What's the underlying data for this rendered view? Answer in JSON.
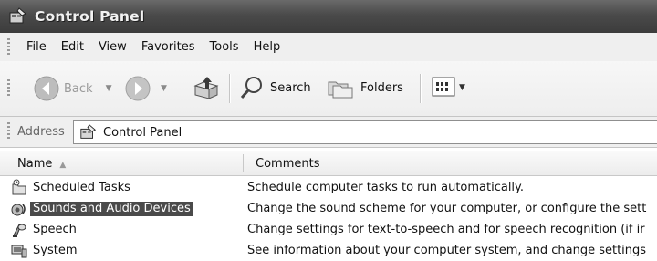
{
  "window": {
    "title": "Control Panel",
    "title_icon": "control-panel-icon"
  },
  "menu": [
    "File",
    "Edit",
    "View",
    "Favorites",
    "Tools",
    "Help"
  ],
  "toolbar": {
    "back_label": "Back",
    "search_label": "Search",
    "folders_label": "Folders",
    "icons": {
      "back": "back-arrow-icon",
      "forward": "forward-arrow-icon",
      "up": "up-folder-icon",
      "search": "search-icon",
      "folders": "folders-icon",
      "views": "views-icon"
    }
  },
  "address": {
    "label": "Address",
    "value": "Control Panel"
  },
  "columns": {
    "name": "Name",
    "comments": "Comments"
  },
  "rows": [
    {
      "name": "Scheduled Tasks",
      "comment": "Schedule computer tasks to run automatically.",
      "selected": false,
      "icon": "scheduled-tasks-icon"
    },
    {
      "name": "Sounds and Audio Devices",
      "comment": "Change the sound scheme for your computer, or configure the sett",
      "selected": true,
      "icon": "sounds-audio-icon"
    },
    {
      "name": "Speech",
      "comment": "Change settings for text-to-speech and for speech recognition (if ir",
      "selected": false,
      "icon": "speech-icon"
    },
    {
      "name": "System",
      "comment": "See information about your computer system, and change settings",
      "selected": false,
      "icon": "system-icon"
    }
  ],
  "colors": {
    "title_bar": "#4a4a4a",
    "selection": "#4a4a4a"
  }
}
